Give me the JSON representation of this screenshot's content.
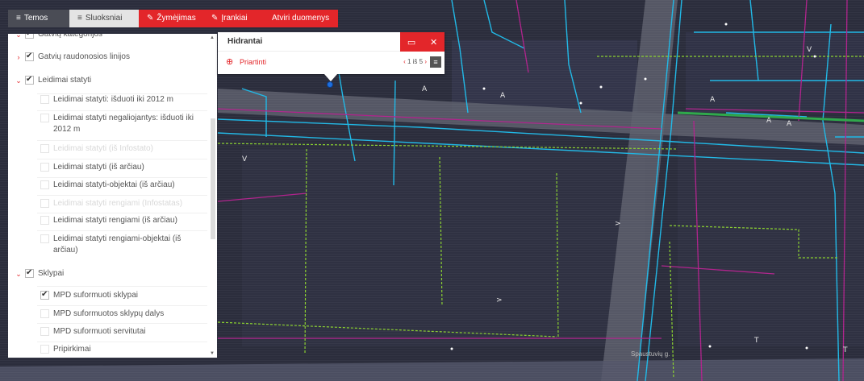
{
  "topnav": {
    "tabs": [
      {
        "icon": "≡",
        "label": "Temos",
        "style": "dark"
      },
      {
        "icon": "≡",
        "label": "Sluoksniai",
        "style": "active"
      },
      {
        "icon": "✎",
        "label": "Žymėjimas",
        "style": "red"
      },
      {
        "icon": "✎",
        "label": "Įrankiai",
        "style": "red"
      },
      {
        "icon": "",
        "label": "Atviri duomenys",
        "style": "red"
      }
    ]
  },
  "layers": {
    "items": [
      {
        "label": "Gatvių kategorijos",
        "level": 0,
        "checked": true,
        "expanded": true
      },
      {
        "label": "Gatvių raudonosios linijos",
        "level": 0,
        "checked": true,
        "expanded": false
      },
      {
        "label": "Leidimai statyti",
        "level": 0,
        "checked": true,
        "expanded": true
      },
      {
        "label": "Leidimai statyti: išduoti iki 2012 m",
        "level": 1,
        "checked": false
      },
      {
        "label": "Leidimai statyti negaliojantys: išduoti iki 2012 m",
        "level": 1,
        "checked": false
      },
      {
        "label": "Leidimai statyti (iš Infostato)",
        "level": 1,
        "checked": false,
        "faded": true
      },
      {
        "label": "Leidimai statyti (iš arčiau)",
        "level": 1,
        "checked": false
      },
      {
        "label": "Leidimai statyti-objektai (iš arčiau)",
        "level": 1,
        "checked": false
      },
      {
        "label": "Leidimai statyti rengiami (Infostatas)",
        "level": 1,
        "checked": false,
        "faded": true
      },
      {
        "label": "Leidimai statyti rengiami (iš arčiau)",
        "level": 1,
        "checked": false
      },
      {
        "label": "Leidimai statyti rengiami-objektai (iš arčiau)",
        "level": 1,
        "checked": false
      },
      {
        "label": "Sklypai",
        "level": 0,
        "checked": true,
        "expanded": true
      },
      {
        "label": "MPD suformuoti sklypai",
        "level": 1,
        "checked": true
      },
      {
        "label": "MPD suformuotos sklypų dalys",
        "level": 1,
        "checked": false
      },
      {
        "label": "MPD suformuoti servitutai",
        "level": 1,
        "checked": false
      },
      {
        "label": "Pripirkimai",
        "level": 1,
        "checked": false
      }
    ]
  },
  "popup": {
    "title": "Hidrantai",
    "zoom_label": "Priartinti",
    "pager": "1 iš 5",
    "prev": "‹",
    "next": "›",
    "maximize_icon": "▭",
    "close_icon": "✕",
    "menu_icon": "≡"
  },
  "map": {
    "street_label": "Spaustuvių g.",
    "colors": {
      "background": "#2b2d3c",
      "building": "#3b3d4c",
      "road_gray": "#6b6d78",
      "cyan": "#1fb8e6",
      "magenta": "#b0228c",
      "green_dashed": "#8ad12f",
      "accent_red": "#e3262a"
    }
  }
}
